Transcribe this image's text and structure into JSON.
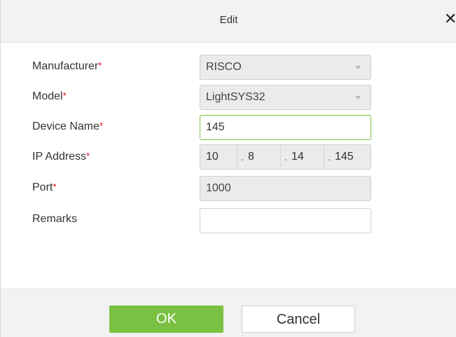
{
  "dialog": {
    "title": "Edit",
    "close_glyph": "✕"
  },
  "form": {
    "required_mark": "*",
    "manufacturer": {
      "label": "Manufacturer",
      "value": "RISCO"
    },
    "model": {
      "label": "Model",
      "value": "LightSYS32"
    },
    "device_name": {
      "label": "Device Name",
      "value": "145"
    },
    "ip_address": {
      "label": "IP Address",
      "octets": [
        "10",
        "8",
        "14",
        "145"
      ],
      "separator": "."
    },
    "port": {
      "label": "Port",
      "value": "1000"
    },
    "remarks": {
      "label": "Remarks",
      "value": ""
    }
  },
  "buttons": {
    "ok": "OK",
    "cancel": "Cancel"
  },
  "colors": {
    "ok_green": "#7ac143",
    "focus_border": "#7cc243",
    "required_red": "#e60012"
  },
  "icons": {
    "close": "close-icon",
    "dropdown": "chevron-down-icon"
  }
}
